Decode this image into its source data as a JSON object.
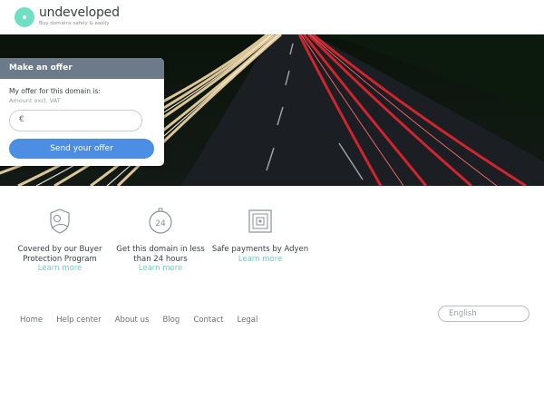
{
  "brand": {
    "name": "undeveloped",
    "tagline": "Buy domains safely & easily"
  },
  "offer": {
    "header": "Make an offer",
    "label": "My offer for this domain is:",
    "sublabel": "Amount excl. VAT",
    "currency_symbol": "€",
    "input_value": "",
    "button_label": "Send your offer"
  },
  "features": [
    {
      "icon": "shield-hand-icon",
      "text": "Covered by our Buyer Protection Program",
      "link": "Learn more"
    },
    {
      "icon": "stopwatch-24-icon",
      "text": "Get this domain in less than 24 hours",
      "link": "Learn more"
    },
    {
      "icon": "safe-icon",
      "text": "Safe payments by Adyen",
      "link": "Learn more"
    }
  ],
  "footer": {
    "links": [
      "Home",
      "Help center",
      "About us",
      "Blog",
      "Contact",
      "Legal"
    ],
    "language": "English"
  },
  "colors": {
    "accent": "#6fe0c4",
    "button": "#4b8ee3",
    "offer_header": "#6d7a8a",
    "link": "#6fd1bd"
  }
}
